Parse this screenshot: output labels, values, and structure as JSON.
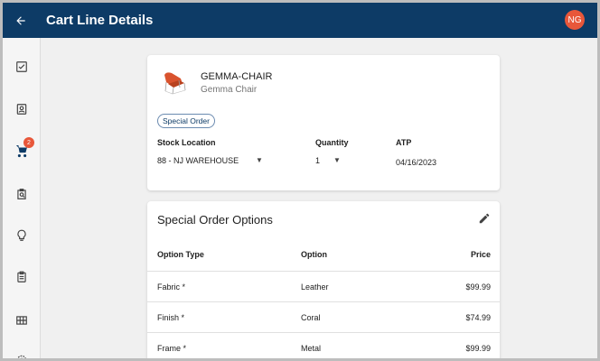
{
  "header": {
    "title": "Cart Line Details",
    "avatar_initials": "NG"
  },
  "sidebar": {
    "items": [
      {
        "icon": "checklist-icon"
      },
      {
        "icon": "contact-card-icon"
      },
      {
        "icon": "cart-icon",
        "badge": "2"
      },
      {
        "icon": "search-document-icon"
      },
      {
        "icon": "lightbulb-icon"
      },
      {
        "icon": "clipboard-icon"
      },
      {
        "icon": "grid-icon"
      },
      {
        "icon": "gear-icon"
      }
    ]
  },
  "product": {
    "code": "GEMMA-CHAIR",
    "name": "Gemma Chair",
    "chip": "Special Order",
    "stock_location_label": "Stock Location",
    "stock_location_value": "88 - NJ WAREHOUSE",
    "quantity_label": "Quantity",
    "quantity_value": "1",
    "atp_label": "ATP",
    "atp_value": "04/16/2023"
  },
  "options": {
    "title": "Special Order Options",
    "columns": [
      "Option Type",
      "Option",
      "Price"
    ],
    "rows": [
      {
        "type": "Fabric *",
        "option": "Leather",
        "price": "$99.99"
      },
      {
        "type": "Finish *",
        "option": "Coral",
        "price": "$74.99"
      },
      {
        "type": "Frame *",
        "option": "Metal",
        "price": "$99.99"
      }
    ]
  },
  "colors": {
    "header_bg": "#0d3b66",
    "accent": "#e8573a",
    "chair": "#d9532e"
  }
}
